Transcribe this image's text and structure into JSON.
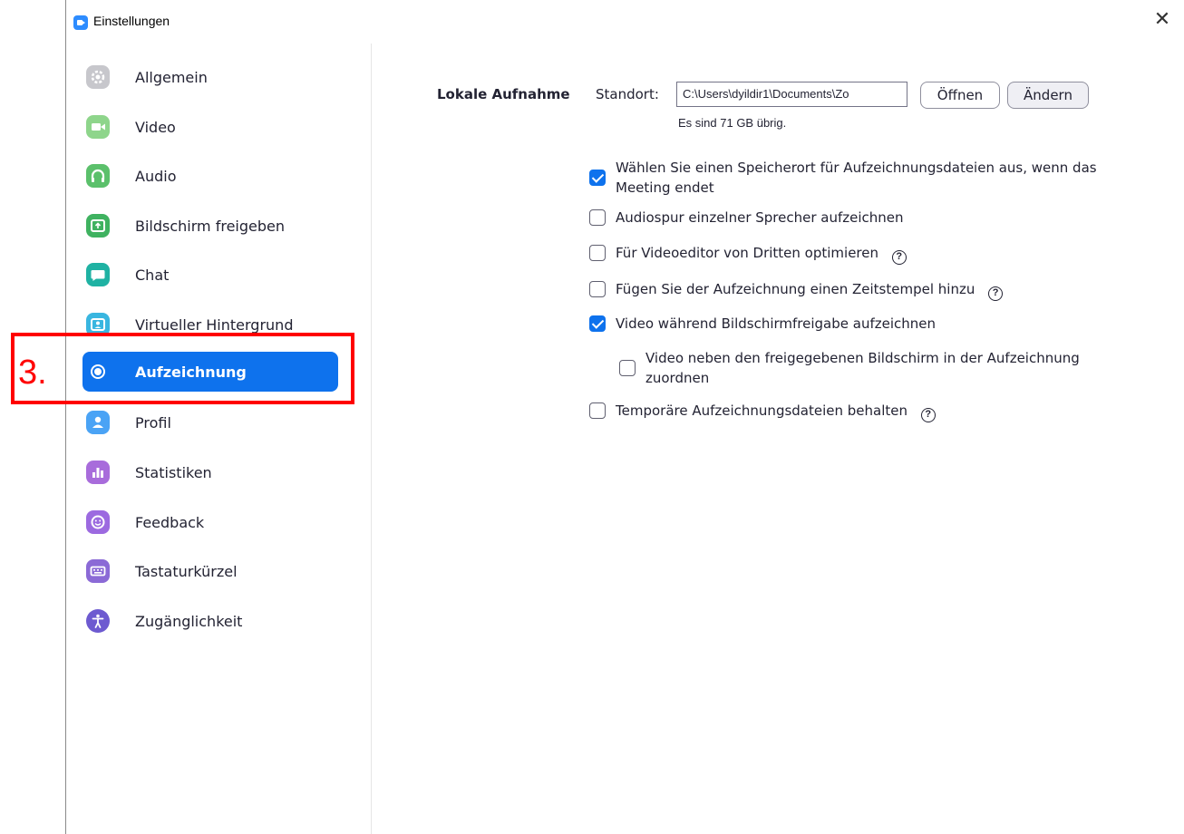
{
  "window": {
    "title": "Einstellungen",
    "close_glyph": "✕"
  },
  "sidebar": {
    "items": [
      {
        "label": "Allgemein",
        "icon": "gear-icon",
        "color": "#c7c7cc"
      },
      {
        "label": "Video",
        "icon": "camera-icon",
        "color": "#8ed58b"
      },
      {
        "label": "Audio",
        "icon": "headphones-icon",
        "color": "#5bc06b"
      },
      {
        "label": "Bildschirm freigeben",
        "icon": "share-screen-icon",
        "color": "#3fb260"
      },
      {
        "label": "Chat",
        "icon": "chat-bubble-icon",
        "color": "#1fb2a3"
      },
      {
        "label": "Virtueller Hintergrund",
        "icon": "person-background-icon",
        "color": "#39b6e0"
      },
      {
        "label": "Aufzeichnung",
        "icon": "record-icon",
        "color": "#0e72ed",
        "active": true
      },
      {
        "label": "Profil",
        "icon": "user-icon",
        "color": "#4aa3f5"
      },
      {
        "label": "Statistiken",
        "icon": "bar-chart-icon",
        "color": "#a86cdb"
      },
      {
        "label": "Feedback",
        "icon": "smiley-icon",
        "color": "#9c6ae0"
      },
      {
        "label": "Tastaturkürzel",
        "icon": "keyboard-icon",
        "color": "#8b6ad6"
      },
      {
        "label": "Zugänglichkeit",
        "icon": "accessibility-icon",
        "color": "#6d5ad0"
      }
    ]
  },
  "annotation": {
    "number": "3.",
    "color": "#ff0000"
  },
  "recording": {
    "section_label": "Lokale Aufnahme",
    "location_label": "Standort:",
    "path_value": "C:\\Users\\dyildir1\\Documents\\Zo",
    "open_button": "Öffnen",
    "change_button": "Ändern",
    "free_space": "Es sind 71 GB übrig.",
    "options": [
      {
        "line1": "Wählen Sie einen Speicherort für Aufzeichnungsdateien aus, wenn das",
        "line2": "Meeting endet",
        "checked": true,
        "help": false
      },
      {
        "line1": "Audiospur einzelner Sprecher aufzeichnen",
        "checked": false,
        "help": false
      },
      {
        "line1": "Für Videoeditor von Dritten optimieren",
        "checked": false,
        "help": true
      },
      {
        "line1": "Fügen Sie der Aufzeichnung einen Zeitstempel hinzu",
        "checked": false,
        "help": true
      },
      {
        "line1": "Video während Bildschirmfreigabe aufzeichnen",
        "checked": true,
        "help": false
      },
      {
        "line1": "Video neben den freigegebenen Bildschirm in der Aufzeichnung",
        "line2": "zuordnen",
        "checked": false,
        "help": false,
        "indent": true
      },
      {
        "line1": "Temporäre Aufzeichnungsdateien behalten",
        "checked": false,
        "help": true
      }
    ],
    "help_glyph": "?"
  },
  "accent_color": "#0e72ed"
}
